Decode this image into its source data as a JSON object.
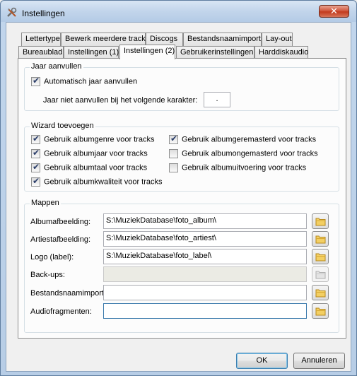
{
  "window": {
    "title": "Instellingen",
    "title_icon": "tools-icon",
    "close_icon": "close-icon"
  },
  "tabs": {
    "row_back": [
      "Lettertype",
      "Bewerk meerdere tracks",
      "Discogs",
      "Bestandsnaamimport",
      "Lay-out"
    ],
    "row_front": [
      "Bureaublad",
      "Instellingen (1)",
      "Instellingen (2)",
      "Gebruikerinstellingen",
      "Harddiskaudio"
    ],
    "active": "Instellingen (2)"
  },
  "jaar": {
    "legend": "Jaar aanvullen",
    "auto_label": "Automatisch jaar aanvullen",
    "auto_checked": true,
    "char_label": "Jaar niet aanvullen bij het volgende karakter:",
    "char_value": "."
  },
  "wizard": {
    "legend": "Wizard toevoegen",
    "items": [
      {
        "label": "Gebruik albumgenre voor tracks",
        "checked": true
      },
      {
        "label": "Gebruik albumjaar voor tracks",
        "checked": true
      },
      {
        "label": "Gebruik albumtaal voor tracks",
        "checked": true
      },
      {
        "label": "Gebruik albumkwaliteit voor tracks",
        "checked": true
      },
      {
        "label": "Gebruik albumgeremasterd voor tracks",
        "checked": true
      },
      {
        "label": "Gebruik albumongemasterd voor tracks",
        "checked": false
      },
      {
        "label": "Gebruik albumuitvoering voor tracks",
        "checked": false
      }
    ]
  },
  "mappen": {
    "legend": "Mappen",
    "rows": [
      {
        "label": "Albumafbeelding:",
        "value": "S:\\MuziekDatabase\\foto_album\\",
        "enabled": true
      },
      {
        "label": "Artiestafbeelding:",
        "value": "S:\\MuziekDatabase\\foto_artiest\\",
        "enabled": true
      },
      {
        "label": "Logo (label):",
        "value": "S:\\MuziekDatabase\\foto_label\\",
        "enabled": true
      },
      {
        "label": "Back-ups:",
        "value": "",
        "enabled": false
      },
      {
        "label": "Bestandsnaamimport:",
        "value": "",
        "enabled": true
      },
      {
        "label": "Audiofragmenten:",
        "value": "",
        "enabled": true
      }
    ]
  },
  "buttons": {
    "ok": "OK",
    "cancel": "Annuleren"
  },
  "colors": {
    "titlebar": "#c2d5eb",
    "close": "#c23a1d",
    "checkmark": "#2a3d69",
    "folder": "#e8b94a"
  }
}
